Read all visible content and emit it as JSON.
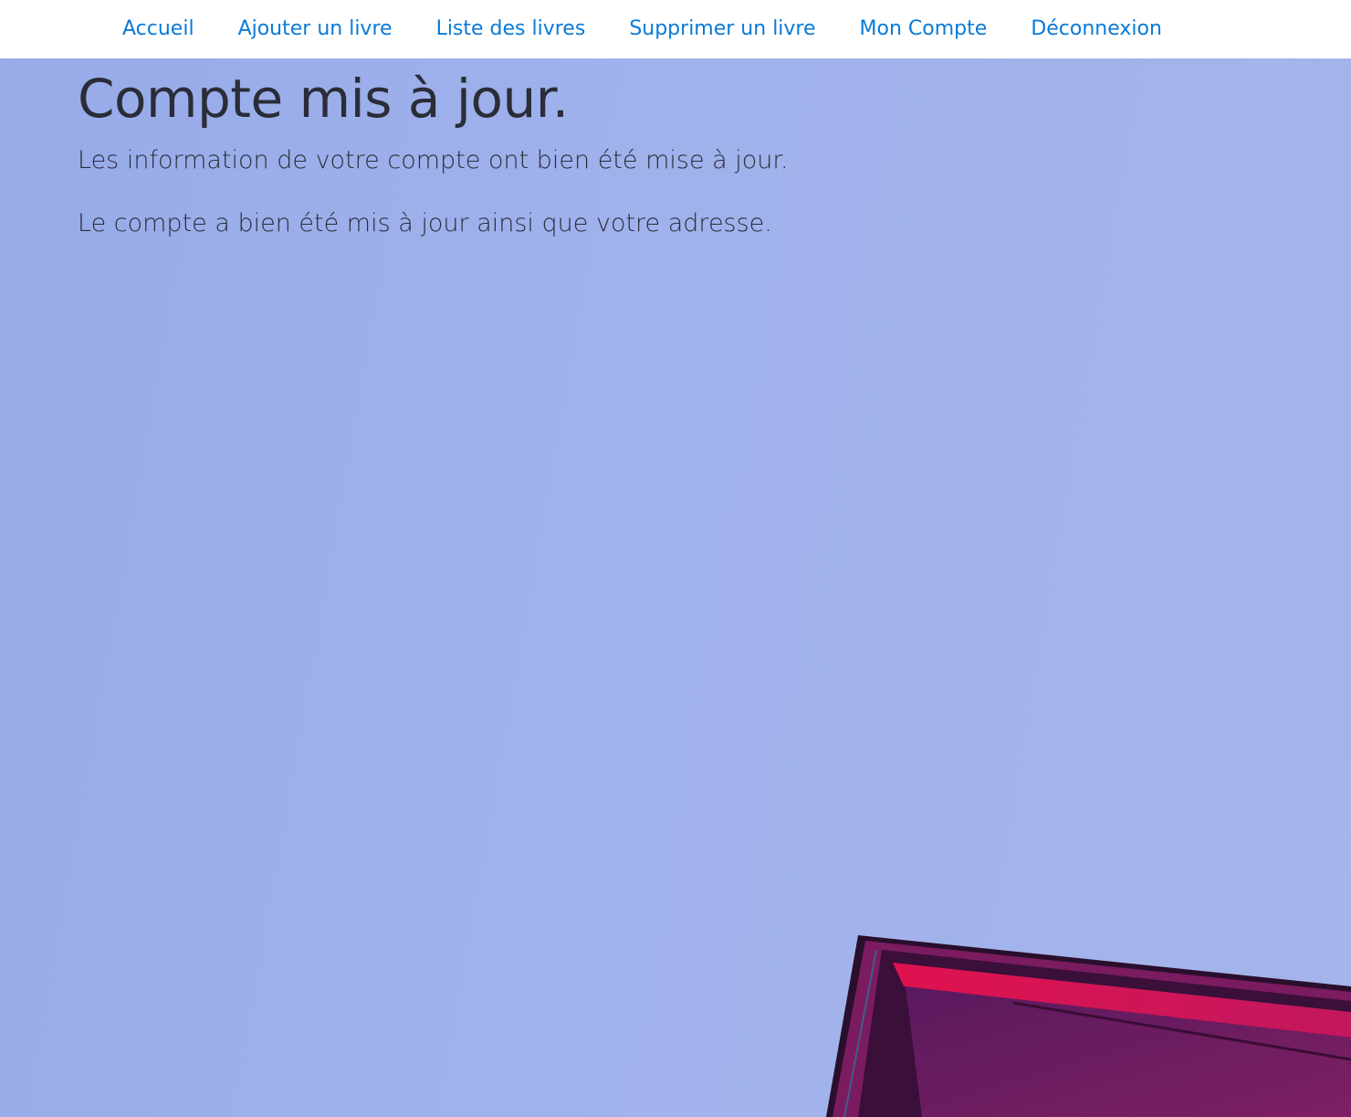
{
  "nav": {
    "items": [
      {
        "label": "Accueil"
      },
      {
        "label": "Ajouter un livre"
      },
      {
        "label": "Liste des livres"
      },
      {
        "label": "Supprimer un livre"
      },
      {
        "label": "Mon Compte"
      },
      {
        "label": "Déconnexion"
      }
    ]
  },
  "main": {
    "title": "Compte mis à jour.",
    "lead": "Les information de votre compte ont bien été mise à jour.",
    "message": "Le compte a bien été mis à jour ainsi que votre adresse."
  },
  "colors": {
    "link": "#0a7ad8",
    "background": "#a0b2ec",
    "text": "#2a2d38",
    "accent_magenta": "#b4145c"
  }
}
